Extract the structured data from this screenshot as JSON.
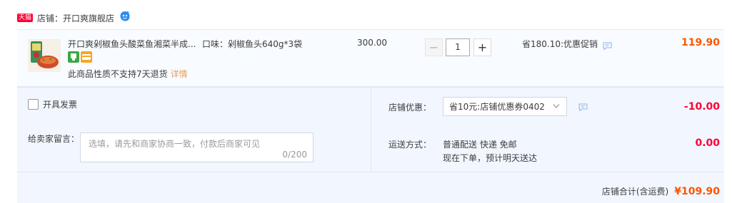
{
  "shop": {
    "badge": "天猫",
    "label": "店铺：",
    "name": "开口爽旗舰店"
  },
  "item": {
    "title": "开口爽剁椒鱼头酸菜鱼湘菜半成...",
    "sku": "口味：剁椒鱼头640g*3袋",
    "note": "此商品性质不支持7天退货",
    "note_link": "详情",
    "unit_price": "300.00",
    "quantity": "1",
    "minus_label": "−",
    "plus_label": "+",
    "promo": "省180.10:优惠促销",
    "total": "119.90"
  },
  "invoice": {
    "label": "开具发票",
    "checked": false
  },
  "memo": {
    "label": "给卖家留言：",
    "placeholder": "选填，请先和商家协商一致，付款后商家可见",
    "count": "0/200"
  },
  "discount": {
    "label": "店铺优惠：",
    "selected": "省10元:店铺优惠券0402",
    "amount": "-10.00"
  },
  "shipping": {
    "label": "运送方式：",
    "method": "普通配送 快递 免邮",
    "eta": "现在下单，预计明天送达",
    "cost": "0.00"
  },
  "summary": {
    "label": "店铺合计(含运费)",
    "value": "¥109.90"
  },
  "colors": {
    "price_orange": "#ff5500",
    "price_red": "#ff0036",
    "panel_bg": "#f2f7ff",
    "link_orange": "#e5a25c"
  },
  "icons": [
    "tmall-badge",
    "wangwang-chat-icon",
    "product-thumbnail",
    "service-icon-green",
    "service-icon-card",
    "message-icon",
    "chevron-down-icon"
  ]
}
